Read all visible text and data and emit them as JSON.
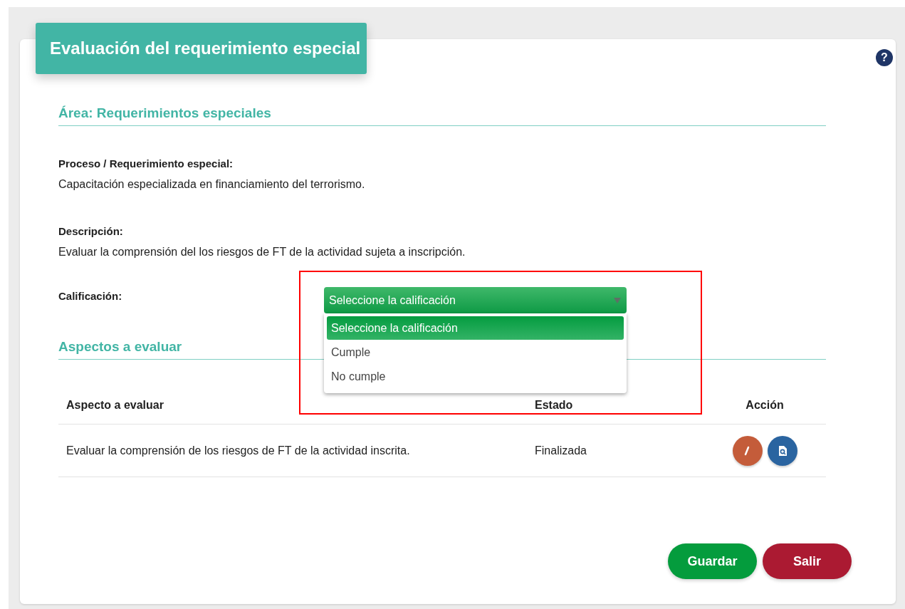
{
  "title": "Evaluación del requerimiento especial",
  "help": {
    "label": "?"
  },
  "area_heading": "Área: Requerimientos especiales",
  "fields": [
    {
      "label": "Proceso / Requerimiento especial:",
      "value": "Capacitación especializada en financiamiento del terrorismo."
    },
    {
      "label": "Descripción:",
      "value": "Evaluar la comprensión del los riesgos de FT de la actividad sujeta a inscripción."
    }
  ],
  "rating": {
    "label": "Calificación:",
    "value": "Seleccione la calificación",
    "expanded": true,
    "highlighted": true,
    "options": [
      {
        "label": "Seleccione la calificación",
        "selected": true
      },
      {
        "label": "Cumple",
        "selected": false
      },
      {
        "label": "No cumple",
        "selected": false
      }
    ]
  },
  "aspects_heading": "Aspectos a evaluar",
  "table": {
    "columns": [
      "Aspecto a evaluar",
      "Estado",
      "Acción"
    ],
    "rows": [
      {
        "aspect": "Evaluar la comprensión de los riesgos de FT de la actividad inscrita.",
        "status": "Finalizada",
        "actions": [
          {
            "kind": "edit"
          },
          {
            "kind": "view"
          }
        ]
      }
    ]
  },
  "buttons": [
    {
      "label": "Guardar",
      "kind": "primary"
    },
    {
      "label": "Salir",
      "kind": "danger"
    }
  ]
}
